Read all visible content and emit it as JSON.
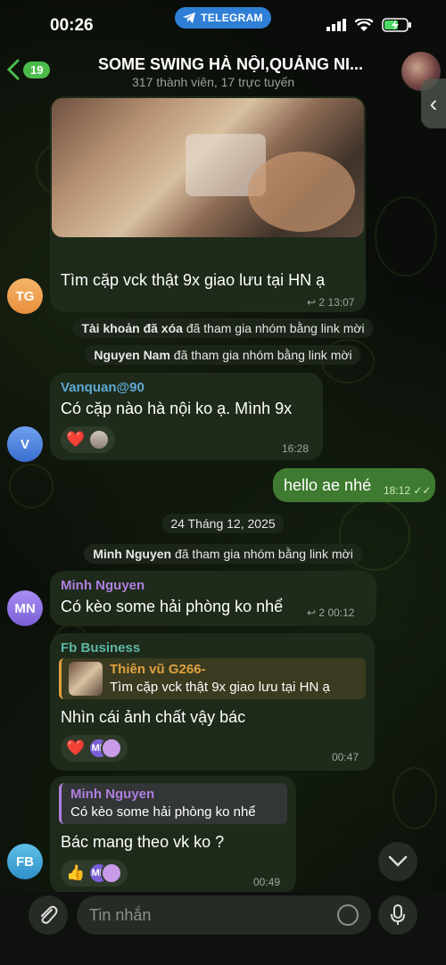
{
  "status_bar": {
    "time": "00:26",
    "telegram_pill": "TELEGRAM"
  },
  "header": {
    "back_badge": "19",
    "title": "SOME SWING HÀ NỘI,QUẢNG NI...",
    "subtitle": "317 thành viên, 17 trực tuyến"
  },
  "messages": {
    "m1": {
      "avatar": "TG",
      "text": "Tìm cặp vck thật 9x giao lưu tại HN ạ",
      "replies": "2",
      "time": "13:07"
    },
    "sys1": {
      "name": "Tài khoản đã xóa",
      "text": " đã tham gia nhóm bằng link mời"
    },
    "sys2": {
      "name": "Nguyen Nam",
      "text": " đã tham gia nhóm bằng link mời"
    },
    "m2": {
      "avatar": "V",
      "sender": "Vanquan@90",
      "text": "Có cặp nào hà nội ko ạ. Mình 9x",
      "reaction": "❤️",
      "time": "16:28"
    },
    "m3": {
      "text": "hello ae nhé",
      "time": "18:12"
    },
    "date": "24 Tháng 12, 2025",
    "sys3": {
      "name": "Minh Nguyen",
      "text": " đã tham gia nhóm bằng link mời"
    },
    "m4": {
      "avatar": "MN",
      "sender": "Minh Nguyen",
      "text": "Có kèo some hải phòng ko nhể",
      "replies": "2",
      "time": "00:12"
    },
    "m5": {
      "sender": "Fb Business",
      "reply_name": "Thiên vũ G266-",
      "reply_text": "Tìm cặp vck thật 9x giao lưu tại HN ạ",
      "text": "Nhìn cái ảnh chất vậy bác",
      "reaction": "❤️",
      "reaction_av": "MN",
      "time": "00:47"
    },
    "m6": {
      "avatar": "FB",
      "reply_name": "Minh Nguyen",
      "reply_text": "Có kèo some hải phòng ko nhể",
      "text": "Bác mang theo vk ko ?",
      "reaction": "👍",
      "reaction_av": "MN",
      "time": "00:49"
    }
  },
  "input": {
    "placeholder": "Tin nhắn"
  },
  "colors": {
    "accent_green": "#4cbb4c",
    "sender_blue": "#5fa8d3",
    "sender_purple": "#b07fe0",
    "sender_teal": "#5fb7a5",
    "reply_orange": "#e0a040",
    "outgoing_bubble": "#3e7a2f",
    "incoming_bubble": "#1e2a1a"
  }
}
